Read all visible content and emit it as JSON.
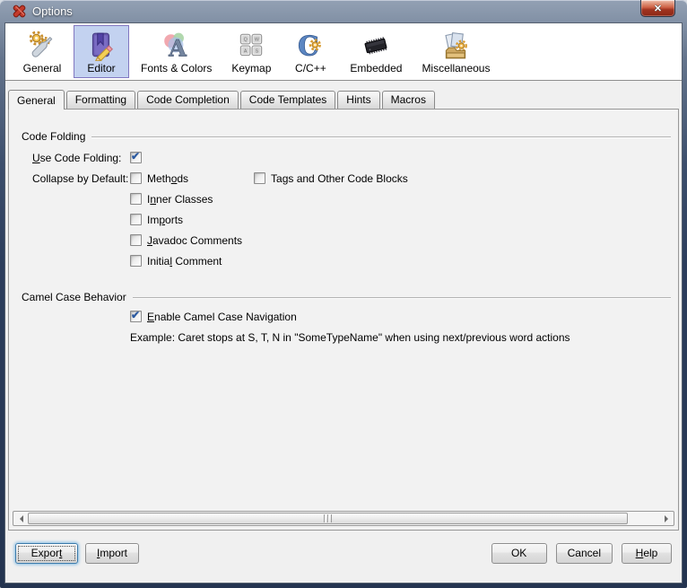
{
  "window": {
    "title": "Options",
    "close_icon": "x-glyph"
  },
  "toolbar": {
    "items": [
      {
        "label": "General",
        "icon": "wrench-gears",
        "selected": false
      },
      {
        "label": "Editor",
        "icon": "book-pencil",
        "selected": true
      },
      {
        "label": "Fonts & Colors",
        "icon": "color-circles-letter-a",
        "selected": false
      },
      {
        "label": "Keymap",
        "icon": "keyboard-keys",
        "selected": false
      },
      {
        "label": "C/C++",
        "icon": "letter-c-gear",
        "selected": false
      },
      {
        "label": "Embedded",
        "icon": "microchip",
        "selected": false
      },
      {
        "label": "Miscellaneous",
        "icon": "papers-gear-tray",
        "selected": false
      }
    ]
  },
  "tabs": [
    {
      "label": "General",
      "active": true
    },
    {
      "label": "Formatting",
      "active": false
    },
    {
      "label": "Code Completion",
      "active": false
    },
    {
      "label": "Code Templates",
      "active": false
    },
    {
      "label": "Hints",
      "active": false
    },
    {
      "label": "Macros",
      "active": false
    }
  ],
  "code_folding": {
    "title": "Code Folding",
    "use_code_folding": {
      "text": "Use Code Folding:",
      "mn": 0,
      "checked": true
    },
    "collapse_by_default": "Collapse by Default:",
    "options": [
      {
        "text": "Methods",
        "mn": 4,
        "checked": false
      },
      {
        "text": "Inner Classes",
        "mn": 1,
        "checked": false
      },
      {
        "text": "Imports",
        "mn": 2,
        "checked": false
      },
      {
        "text": "Javadoc Comments",
        "mn": 0,
        "checked": false
      },
      {
        "text": "Initial Comment",
        "mn": 6,
        "checked": false
      }
    ],
    "options_col2": [
      {
        "text": "Tags and Other Code Blocks",
        "mn": 2,
        "checked": false
      }
    ]
  },
  "camel_case": {
    "title": "Camel Case Behavior",
    "enable": {
      "text": "Enable Camel Case Navigation",
      "mn": 0,
      "checked": true
    },
    "example": "Example: Caret stops at S, T, N in \"SomeTypeName\" when using next/previous word actions"
  },
  "buttons": {
    "export": {
      "text": "Export",
      "mn": 5
    },
    "import": {
      "text": "Import",
      "mn": 0
    },
    "ok": {
      "text": "OK",
      "mn": -1
    },
    "cancel": {
      "text": "Cancel",
      "mn": -1
    },
    "help": {
      "text": "Help",
      "mn": 0
    }
  },
  "accent_colors": {
    "titlebar": "#36496b",
    "selected_item_bg": "#c3d2f0",
    "selected_item_border": "#8177c0",
    "check_color": "#2c5aa0",
    "close_button_red": "#a03420"
  }
}
